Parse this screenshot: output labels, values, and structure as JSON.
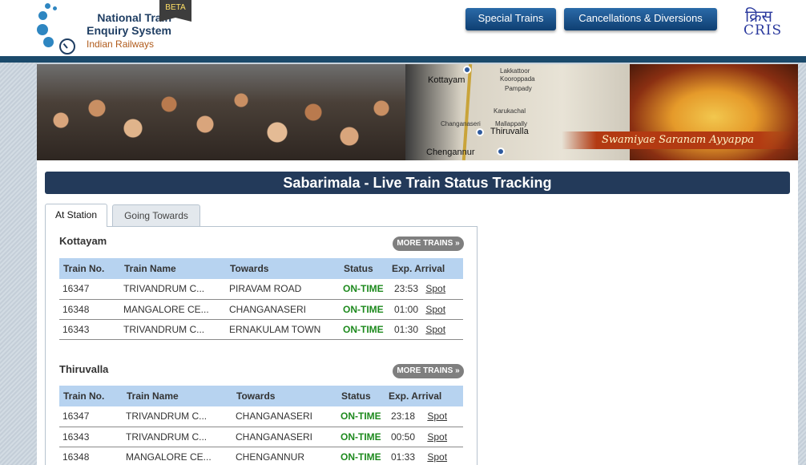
{
  "header": {
    "logo_title": "National Train Enquiry System",
    "logo_subtitle": "Indian Railways",
    "beta": "BETA",
    "nav": [
      "Special Trains",
      "Cancellations & Diversions"
    ],
    "cris_glyph": "क्रिस",
    "cris_text": "CRIS"
  },
  "banner": {
    "map_labels": [
      "Kottayam",
      "Lakkattoor",
      "Kooroppada",
      "Pampady",
      "Karukachal",
      "Changanaseri",
      "Mallappally",
      "Thiruvalla",
      "Chengannur"
    ],
    "ribbon": "Swamiyae Saranam Ayyappa"
  },
  "page_title": "Sabarimala - Live Train Status Tracking",
  "tabs": [
    "At Station",
    "Going Towards"
  ],
  "columns": [
    "Train No.",
    "Train Name",
    "Towards",
    "Status",
    "Exp. Arrival"
  ],
  "more_label": "MORE TRAINS »",
  "stations": [
    {
      "name": "Kottayam",
      "rows": [
        {
          "no": "16347",
          "name": "TRIVANDRUM C...",
          "towards": "PIRAVAM ROAD",
          "status": "ON-TIME",
          "arrival": "23:53",
          "link": "Spot"
        },
        {
          "no": "16348",
          "name": "MANGALORE CE...",
          "towards": "CHANGANASERI",
          "status": "ON-TIME",
          "arrival": "01:00",
          "link": "Spot"
        },
        {
          "no": "16343",
          "name": "TRIVANDRUM C...",
          "towards": "ERNAKULAM TOWN",
          "status": "ON-TIME",
          "arrival": "01:30",
          "link": "Spot"
        }
      ]
    },
    {
      "name": "Thiruvalla",
      "rows": [
        {
          "no": "16347",
          "name": "TRIVANDRUM C...",
          "towards": "CHANGANASERI",
          "status": "ON-TIME",
          "arrival": "23:18",
          "link": "Spot"
        },
        {
          "no": "16343",
          "name": "TRIVANDRUM C...",
          "towards": "CHANGANASERI",
          "status": "ON-TIME",
          "arrival": "00:50",
          "link": "Spot"
        },
        {
          "no": "16348",
          "name": "MANGALORE CE...",
          "towards": "CHENGANNUR",
          "status": "ON-TIME",
          "arrival": "01:33",
          "link": "Spot"
        }
      ]
    }
  ]
}
